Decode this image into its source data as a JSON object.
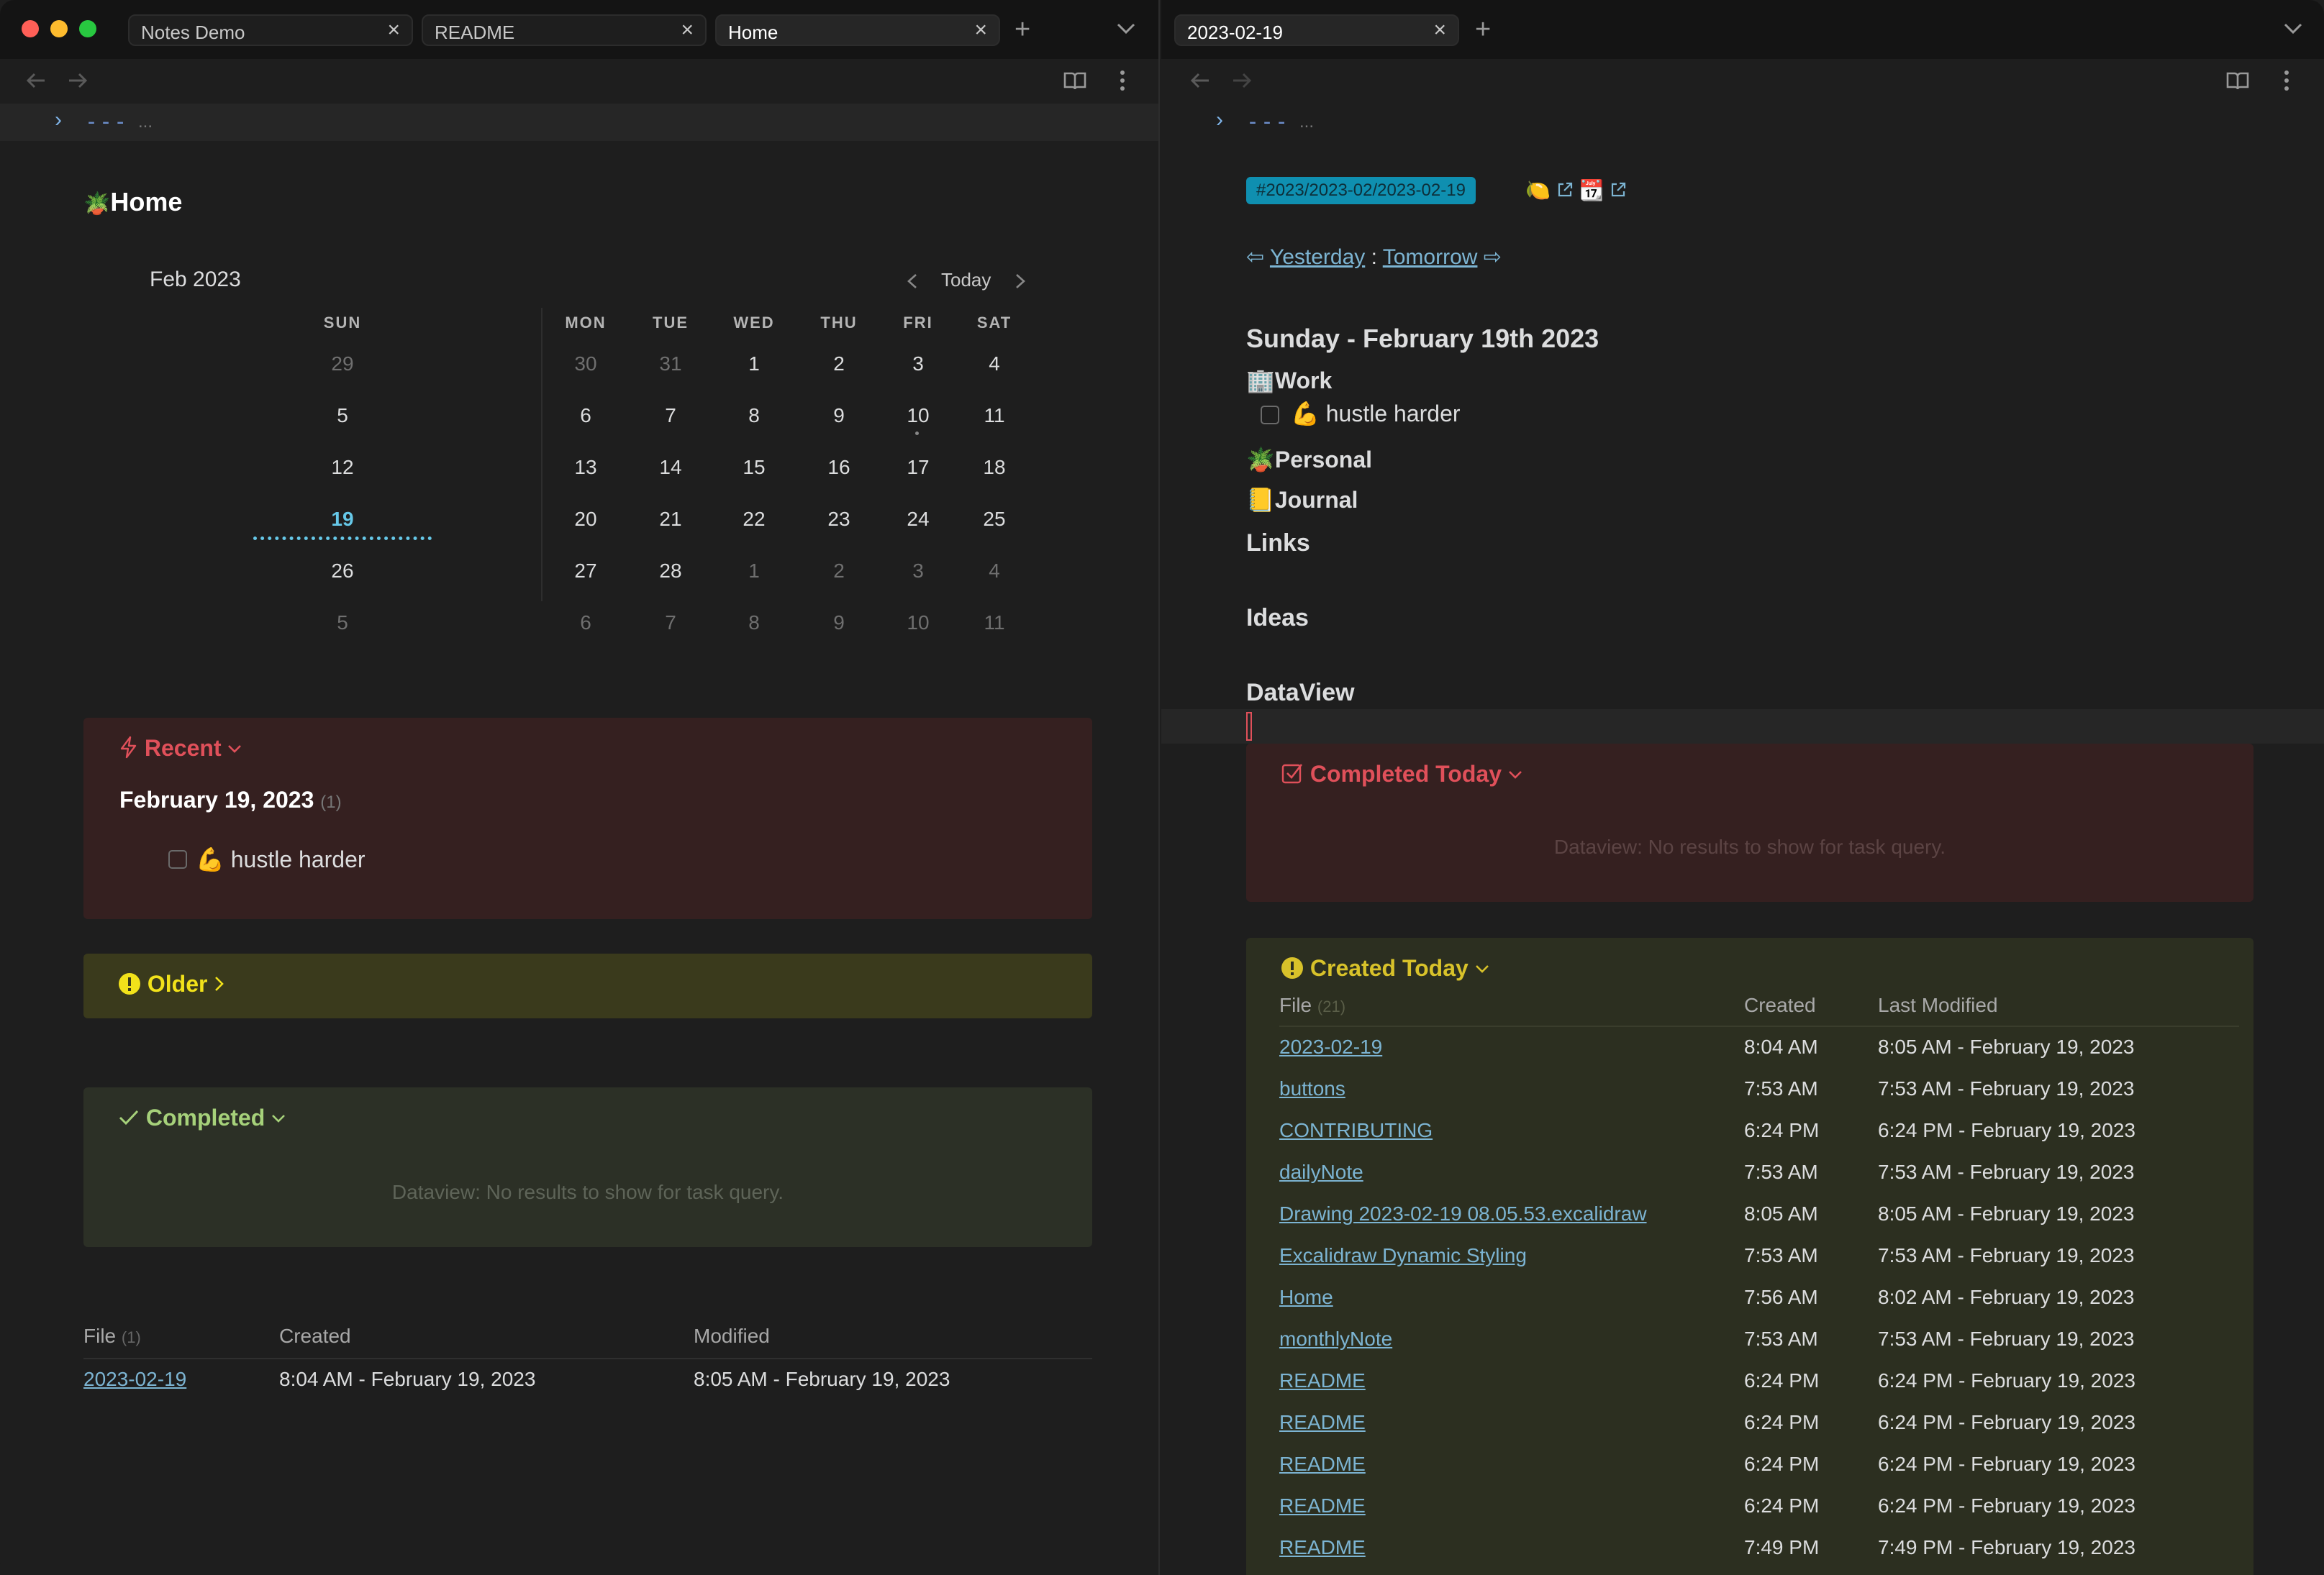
{
  "tabs_left": [
    {
      "label": "Notes Demo"
    },
    {
      "label": "README"
    },
    {
      "label": "Home"
    }
  ],
  "tabs_right": [
    {
      "label": "2023-02-19"
    }
  ],
  "frontmatter": {
    "caret": "›",
    "dashes": "---",
    "ellipsis": "..."
  },
  "home": {
    "title": "Home",
    "calendar": {
      "month": "Feb 2023",
      "today_label": "Today",
      "weekdays": [
        "SUN",
        "MON",
        "TUE",
        "WED",
        "THU",
        "FRI",
        "SAT"
      ],
      "weeks": [
        [
          "29",
          "30",
          "31",
          "1",
          "2",
          "3",
          "4"
        ],
        [
          "5",
          "6",
          "7",
          "8",
          "9",
          "10",
          "11"
        ],
        [
          "12",
          "13",
          "14",
          "15",
          "16",
          "17",
          "18"
        ],
        [
          "19",
          "20",
          "21",
          "22",
          "23",
          "24",
          "25"
        ],
        [
          "26",
          "27",
          "28",
          "1",
          "2",
          "3",
          "4"
        ],
        [
          "5",
          "6",
          "7",
          "8",
          "9",
          "10",
          "11"
        ]
      ]
    },
    "recent": {
      "title": "Recent",
      "date": "February 19, 2023",
      "count": "(1)",
      "task": "hustle harder"
    },
    "older": {
      "title": "Older"
    },
    "completed": {
      "title": "Completed",
      "empty": "Dataview: No results to show for task query."
    },
    "files_table": {
      "headers": [
        "File",
        "Created",
        "Modified"
      ],
      "count": "(1)",
      "rows": [
        {
          "file": "2023-02-19",
          "created": "8:04 AM - February 19, 2023",
          "modified": "8:05 AM - February 19, 2023"
        }
      ]
    }
  },
  "daily": {
    "tag": "#2023/2023-02/2023-02-19",
    "nav": {
      "yesterday": "Yesterday",
      "separator": ":",
      "tomorrow": "Tomorrow"
    },
    "date_heading": "Sunday - February 19th 2023",
    "work": "Work",
    "work_task": "hustle harder",
    "personal": "Personal",
    "journal": "Journal",
    "links": "Links",
    "ideas": "Ideas",
    "dataview": "DataView",
    "completed_today": {
      "title": "Completed Today",
      "empty": "Dataview: No results to show for task query."
    },
    "created_today": {
      "title": "Created Today",
      "headers": [
        "File",
        "Created",
        "Last Modified"
      ],
      "count": "(21)",
      "rows": [
        {
          "file": "2023-02-19",
          "created": "8:04 AM",
          "modified": "8:05 AM - February 19, 2023"
        },
        {
          "file": "buttons",
          "created": "7:53 AM",
          "modified": "7:53 AM - February 19, 2023"
        },
        {
          "file": "CONTRIBUTING",
          "created": "6:24 PM",
          "modified": "6:24 PM - February 19, 2023"
        },
        {
          "file": "dailyNote",
          "created": "7:53 AM",
          "modified": "7:53 AM - February 19, 2023"
        },
        {
          "file": "Drawing 2023-02-19 08.05.53.excalidraw",
          "created": "8:05 AM",
          "modified": "8:05 AM - February 19, 2023"
        },
        {
          "file": "Excalidraw Dynamic Styling",
          "created": "7:53 AM",
          "modified": "7:53 AM - February 19, 2023"
        },
        {
          "file": "Home",
          "created": "7:56 AM",
          "modified": "8:02 AM - February 19, 2023"
        },
        {
          "file": "monthlyNote",
          "created": "7:53 AM",
          "modified": "7:53 AM - February 19, 2023"
        },
        {
          "file": "README",
          "created": "6:24 PM",
          "modified": "6:24 PM - February 19, 2023"
        },
        {
          "file": "README",
          "created": "6:24 PM",
          "modified": "6:24 PM - February 19, 2023"
        },
        {
          "file": "README",
          "created": "6:24 PM",
          "modified": "6:24 PM - February 19, 2023"
        },
        {
          "file": "README",
          "created": "6:24 PM",
          "modified": "6:24 PM - February 19, 2023"
        },
        {
          "file": "README",
          "created": "7:49 PM",
          "modified": "7:49 PM - February 19, 2023"
        }
      ]
    }
  },
  "colors": {
    "accent_link": "#7cb4d2",
    "recent_bg": "#352020",
    "recent_title": "#e0505a",
    "older_bg": "#3a3a1c",
    "older_title": "#f2e21a",
    "completed_bg": "#2c3026",
    "completed_title": "#a6d17a",
    "created_bg": "#2c2f20",
    "created_title": "#d8c22a",
    "tag_bg": "#0f8fb0"
  },
  "icons": {
    "close": "close-icon",
    "plus": "plus-icon",
    "back": "arrow-left-icon",
    "forward": "arrow-right-icon",
    "reading": "book-open-icon",
    "more": "more-vertical-icon",
    "bolt": "bolt-icon",
    "check": "check-icon",
    "warning": "exclamation-icon",
    "checkbox-square": "checkbox-square-icon"
  }
}
